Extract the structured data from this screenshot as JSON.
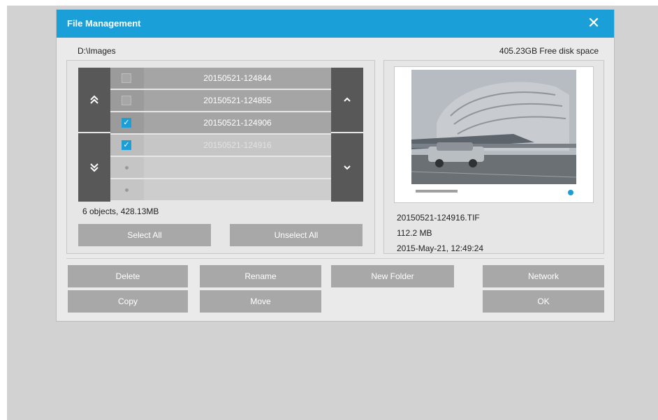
{
  "dialog": {
    "title": "File Management",
    "path": "D:\\Images",
    "free_space": "405.23GB Free disk space"
  },
  "file_list": {
    "items": [
      {
        "name": "20150521-124844",
        "checked": false
      },
      {
        "name": "20150521-124855",
        "checked": false
      },
      {
        "name": "20150521-124906",
        "checked": true
      },
      {
        "name": "20150521-124916",
        "checked": true
      },
      {
        "name": "",
        "checked": false
      },
      {
        "name": "",
        "checked": false
      }
    ],
    "summary": "6 objects, 428.13MB",
    "select_all": "Select All",
    "unselect_all": "Unselect All"
  },
  "preview": {
    "filename": "20150521-124916.TIF",
    "size": "112.2 MB",
    "date": "2015-May-21, 12:49:24"
  },
  "actions": {
    "delete": "Delete",
    "rename": "Rename",
    "new_folder": "New Folder",
    "network": "Network",
    "copy": "Copy",
    "move": "Move",
    "ok": "OK"
  },
  "icons": {
    "close": "close-icon",
    "page_up": "double-chevron-up-icon",
    "page_down": "double-chevron-down-icon",
    "scroll_up": "chevron-up-icon",
    "scroll_down": "chevron-down-icon"
  },
  "colors": {
    "accent": "#1a9fd8",
    "button": "#a8a8a8",
    "nav": "#585858"
  }
}
